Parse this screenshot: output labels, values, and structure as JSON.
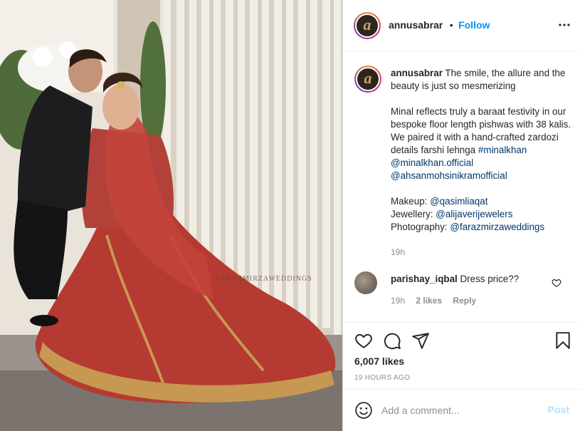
{
  "post": {
    "author": "annusabrar",
    "dot": "•",
    "follow_label": "Follow",
    "photo_watermark": "FARAZMIRZAWEDDINGS",
    "avatar_letter": "a"
  },
  "caption": {
    "author": "annusabrar",
    "line1": "The smile, the allure and the beauty is just so mesmerizing",
    "line2": "Minal reflects truly a baraat festivity in our bespoke floor length pishwas with 38 kalis. We paired it with a hand-crafted zardozi details farshi lehnga",
    "hashtag": "#minalkhan",
    "mention1": "@minalkhan.official",
    "mention2": "@ahsanmohsinikramofficial",
    "makeup_label": "Makeup:",
    "makeup_handle": "@qasimliaqat",
    "jewellery_label": "Jewellery:",
    "jewellery_handle": "@alijaverijewelers",
    "photo_label": "Photography:",
    "photo_handle": "@farazmirzaweddings",
    "age": "19h"
  },
  "comment": {
    "author": "parishay_iqbal",
    "text": "Dress price??",
    "age": "19h",
    "likes": "2 likes",
    "reply": "Reply"
  },
  "actions": {
    "likes_count": "6,007 likes",
    "timestamp": "19 HOURS AGO"
  },
  "add_comment": {
    "placeholder": "Add a comment...",
    "post_label": "Post"
  },
  "colors": {
    "accent": "#0095f6",
    "post_disabled": "#b2dffc",
    "link": "#00376b",
    "muted": "#8e8e8e"
  },
  "icons": {
    "more": "more-horizontal-icon",
    "like": "heart-icon",
    "comment": "comment-bubble-icon",
    "share": "send-icon",
    "save": "bookmark-icon",
    "emoji": "emoji-icon"
  }
}
